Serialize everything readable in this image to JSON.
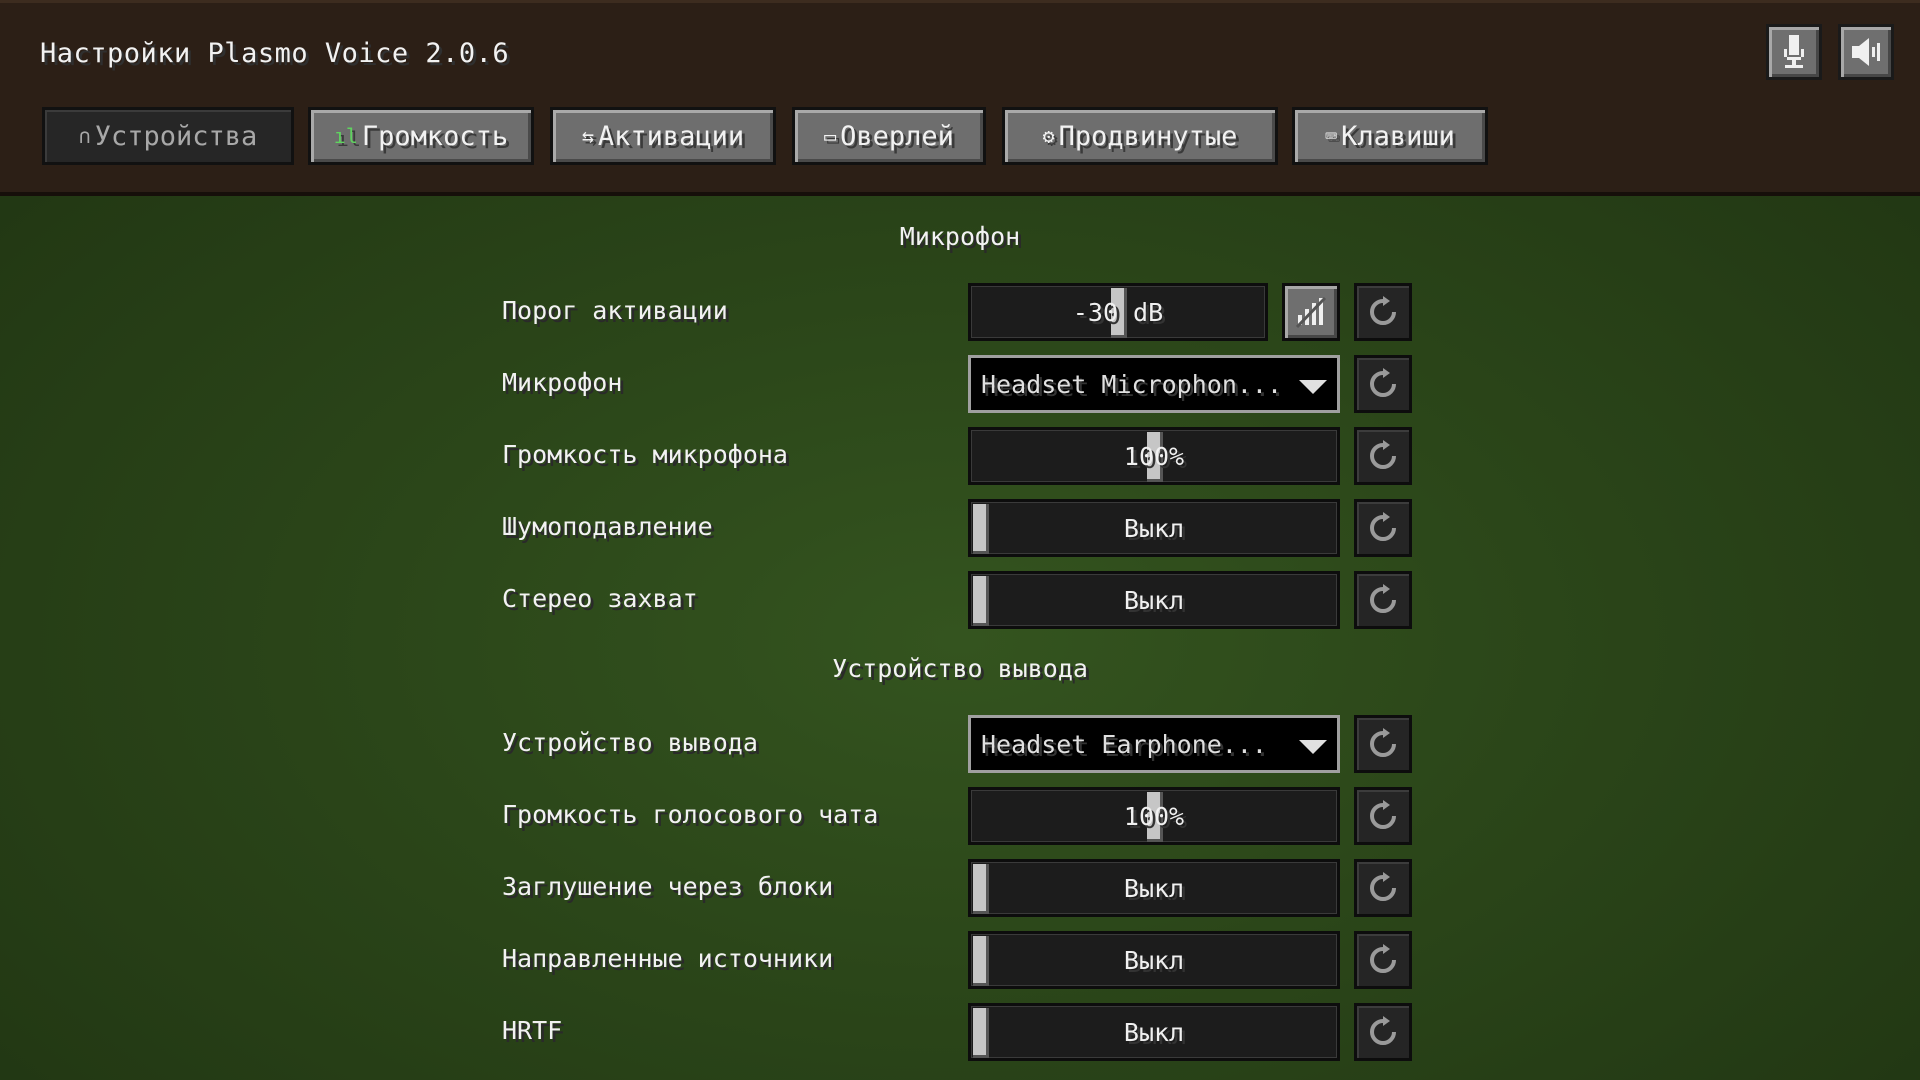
{
  "window": {
    "title": "Настройки Plasmo Voice 2.0.6"
  },
  "header_buttons": [
    {
      "name": "microphone-toggle",
      "icon": "microphone-icon"
    },
    {
      "name": "speaker-toggle",
      "icon": "speaker-icon"
    }
  ],
  "tabs": [
    {
      "label": "Устройства",
      "icon": "headphones-icon",
      "glyph": "∩",
      "active": true
    },
    {
      "label": "Громкость",
      "icon": "volume-bars-icon",
      "glyph": "ıl",
      "active": false
    },
    {
      "label": "Активации",
      "icon": "activation-icon",
      "glyph": "⇆",
      "active": false
    },
    {
      "label": "Оверлей",
      "icon": "monitor-icon",
      "glyph": "▭",
      "active": false
    },
    {
      "label": "Продвинутые",
      "icon": "gear-icon",
      "glyph": "⚙",
      "active": false
    },
    {
      "label": "Клавиши",
      "icon": "keyboard-icon",
      "glyph": "⌨",
      "active": false
    }
  ],
  "sections": {
    "microphone": {
      "title": "Микрофон",
      "activation_threshold": {
        "label": "Порог активации",
        "value": "-30 dB"
      },
      "microphone": {
        "label": "Микрофон",
        "value": "Headset Microphon..."
      },
      "microphone_volume": {
        "label": "Громкость микрофона",
        "value": "100%"
      },
      "noise_suppression": {
        "label": "Шумоподавление",
        "value": "Выкл"
      },
      "stereo_capture": {
        "label": "Стерео захват",
        "value": "Выкл"
      }
    },
    "output": {
      "title": "Устройство вывода",
      "output_device": {
        "label": "Устройство вывода",
        "value": "Headset Earphone..."
      },
      "voice_chat_volume": {
        "label": "Громкость голосового чата",
        "value": "100%"
      },
      "occlusion": {
        "label": "Заглушение через блоки",
        "value": "Выкл"
      },
      "directional_sources": {
        "label": "Направленные источники",
        "value": "Выкл"
      },
      "hrtf": {
        "label": "HRTF",
        "value": "Выкл"
      }
    }
  },
  "colors": {
    "header_bg": "#2c1f16",
    "background": "#2b4619",
    "text": "#f2f2f2"
  }
}
